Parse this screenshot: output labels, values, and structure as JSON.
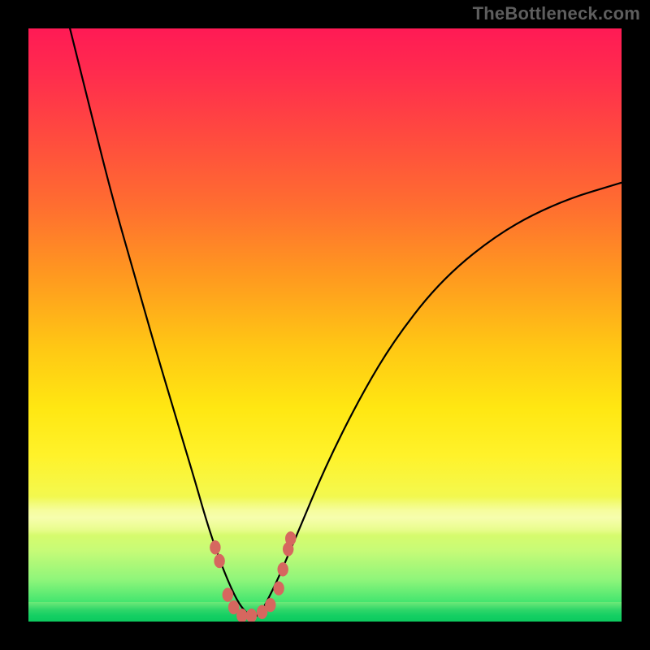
{
  "watermark": "TheBottleneck.com",
  "chart_data": {
    "type": "line",
    "title": "",
    "xlabel": "",
    "ylabel": "",
    "xlim": [
      0,
      100
    ],
    "ylim": [
      0,
      100
    ],
    "grid": false,
    "legend": false,
    "background": {
      "gradient_stops": [
        {
          "pos": 0,
          "color": "#ff1a55"
        },
        {
          "pos": 50,
          "color": "#ffd014"
        },
        {
          "pos": 80,
          "color": "#f5f84a"
        },
        {
          "pos": 100,
          "color": "#14d566"
        }
      ],
      "pale_band_y": [
        79,
        85
      ],
      "green_strip_y": [
        97,
        100
      ]
    },
    "series": [
      {
        "name": "bottleneck-curve",
        "color": "#000000",
        "x": [
          7,
          10,
          14,
          18,
          22,
          25,
          28,
          30,
          32,
          34,
          35.5,
          37,
          38,
          39,
          40,
          42,
          45,
          50,
          56,
          62,
          70,
          80,
          90,
          100
        ],
        "y": [
          100,
          88,
          72,
          58,
          44,
          34,
          24,
          17,
          11,
          6,
          3,
          1.2,
          0.8,
          1.2,
          3,
          7,
          14,
          26,
          38,
          48,
          58,
          66,
          71,
          74
        ]
      }
    ],
    "scatter": [
      {
        "name": "curve-points-lower",
        "color": "#d6675f",
        "x": [
          31.5,
          32.2,
          33.6,
          34.6,
          36.0,
          37.6,
          39.4,
          40.8,
          42.2,
          42.9,
          43.8,
          44.2
        ],
        "y": [
          12.5,
          10.2,
          4.5,
          2.4,
          1.0,
          1.0,
          1.6,
          2.8,
          5.6,
          8.8,
          12.2,
          14.0
        ]
      }
    ]
  }
}
